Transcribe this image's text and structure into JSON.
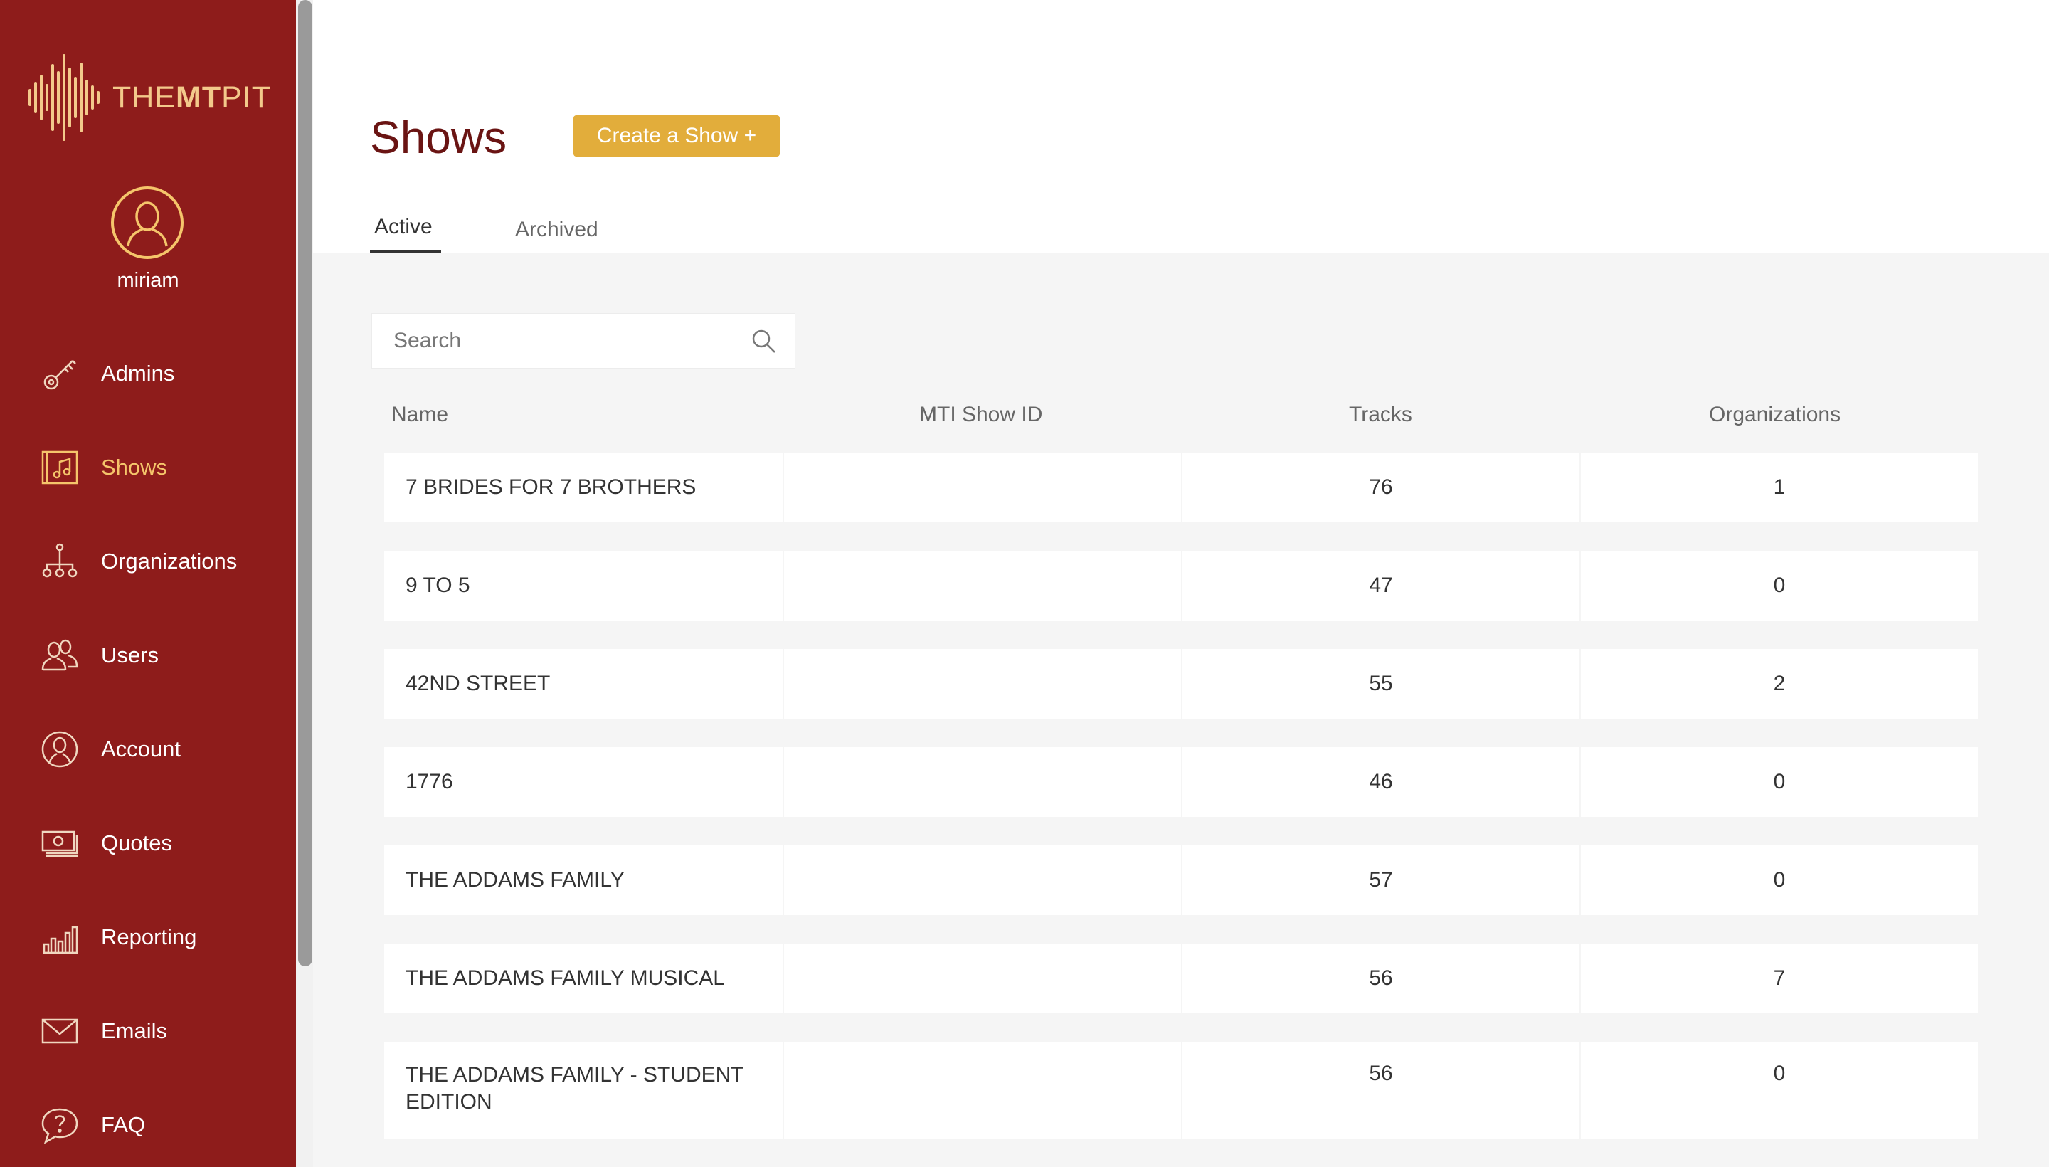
{
  "app": {
    "logo_prefix": "THE",
    "logo_bold": "MT",
    "logo_suffix": "PIT",
    "brand_color": "#8e1c1b",
    "accent_color": "#f5c56b"
  },
  "user": {
    "name": "miriam",
    "icon": "user-avatar-icon"
  },
  "sidebar": {
    "items": [
      {
        "label": "Admins",
        "icon": "key-icon",
        "active": false
      },
      {
        "label": "Shows",
        "icon": "music-note-icon",
        "active": true
      },
      {
        "label": "Organizations",
        "icon": "org-tree-icon",
        "active": false
      },
      {
        "label": "Users",
        "icon": "users-icon",
        "active": false
      },
      {
        "label": "Account",
        "icon": "account-icon",
        "active": false
      },
      {
        "label": "Quotes",
        "icon": "money-icon",
        "active": false
      },
      {
        "label": "Reporting",
        "icon": "bar-chart-icon",
        "active": false
      },
      {
        "label": "Emails",
        "icon": "envelope-icon",
        "active": false
      },
      {
        "label": "FAQ",
        "icon": "question-bubble-icon",
        "active": false
      }
    ]
  },
  "header": {
    "title": "Shows",
    "create_button": "Create a Show +",
    "create_button_color": "#e2ad3b"
  },
  "tabs": [
    {
      "label": "Active",
      "active": true
    },
    {
      "label": "Archived",
      "active": false
    }
  ],
  "search": {
    "placeholder": "Search",
    "value": ""
  },
  "table": {
    "columns": [
      "Name",
      "MTI Show ID",
      "Tracks",
      "Organizations"
    ],
    "rows": [
      {
        "name": "7 BRIDES FOR 7 BROTHERS",
        "mti_id": "",
        "tracks": "76",
        "organizations": "1"
      },
      {
        "name": "9 TO 5",
        "mti_id": "",
        "tracks": "47",
        "organizations": "0"
      },
      {
        "name": "42ND STREET",
        "mti_id": "",
        "tracks": "55",
        "organizations": "2"
      },
      {
        "name": "1776",
        "mti_id": "",
        "tracks": "46",
        "organizations": "0"
      },
      {
        "name": "THE ADDAMS FAMILY",
        "mti_id": "",
        "tracks": "57",
        "organizations": "0"
      },
      {
        "name": "THE ADDAMS FAMILY MUSICAL",
        "mti_id": "",
        "tracks": "56",
        "organizations": "7"
      },
      {
        "name": "THE ADDAMS FAMILY - STUDENT EDITION",
        "mti_id": "",
        "tracks": "56",
        "organizations": "0"
      }
    ]
  }
}
